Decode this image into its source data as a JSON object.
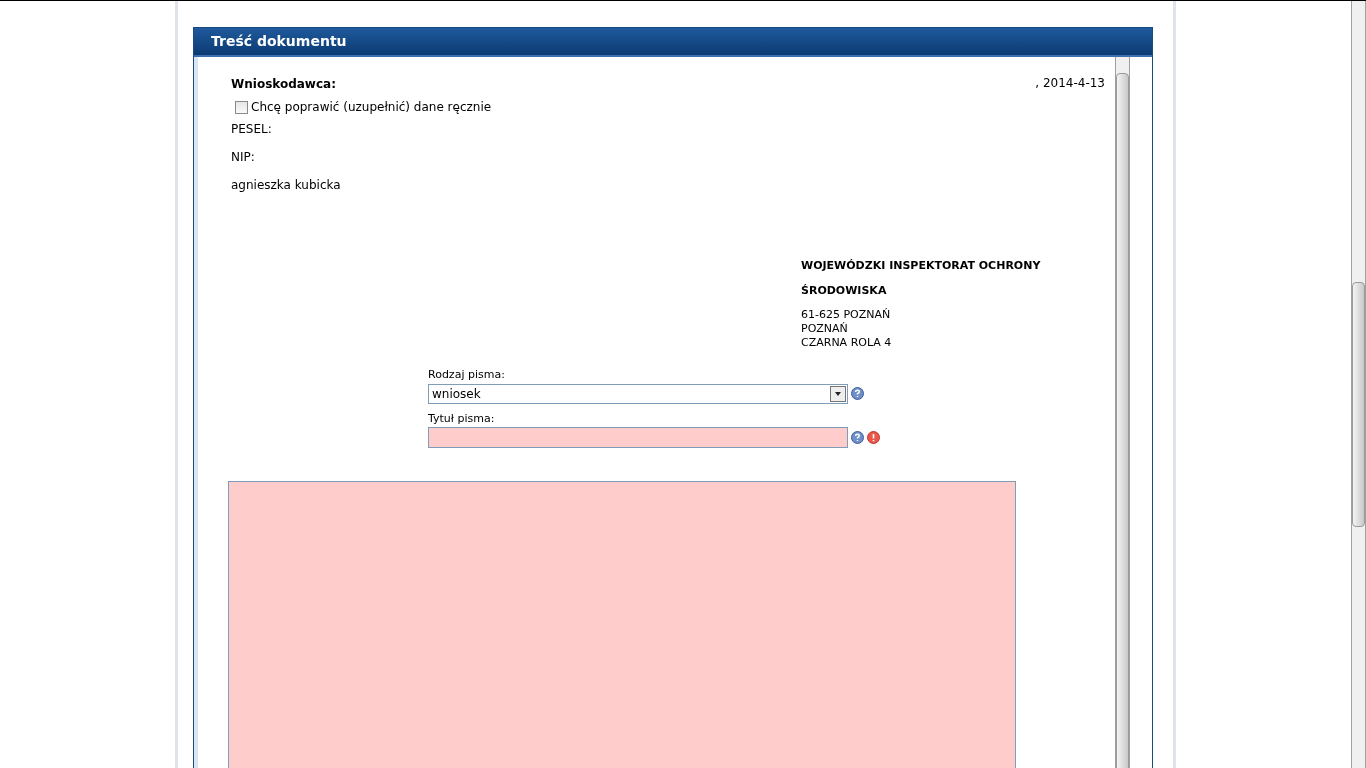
{
  "panel": {
    "title": "Treść dokumentu"
  },
  "applicant": {
    "label": "Wnioskodawca:",
    "date": ", 2014-4-13",
    "manual_edit": {
      "label": "Chcę poprawić (uzupełnić) dane ręcznie",
      "checked": false
    },
    "pesel_label": "PESEL:",
    "nip_label": "NIP:",
    "name": "agnieszka kubicka"
  },
  "recipient": {
    "name_lines": [
      "WOJEWÓDZKI INSPEKTORAT OCHRONY",
      "ŚRODOWISKA"
    ],
    "address_lines": [
      "61-625 POZNAŃ",
      "POZNAŃ",
      "CZARNA ROLA 4"
    ]
  },
  "letter_type": {
    "label": "Rodzaj pisma:",
    "value": "wniosek",
    "invalid": false
  },
  "letter_title": {
    "label": "Tytuł pisma:",
    "invalid": true
  },
  "letter_body": {
    "invalid": true
  }
}
